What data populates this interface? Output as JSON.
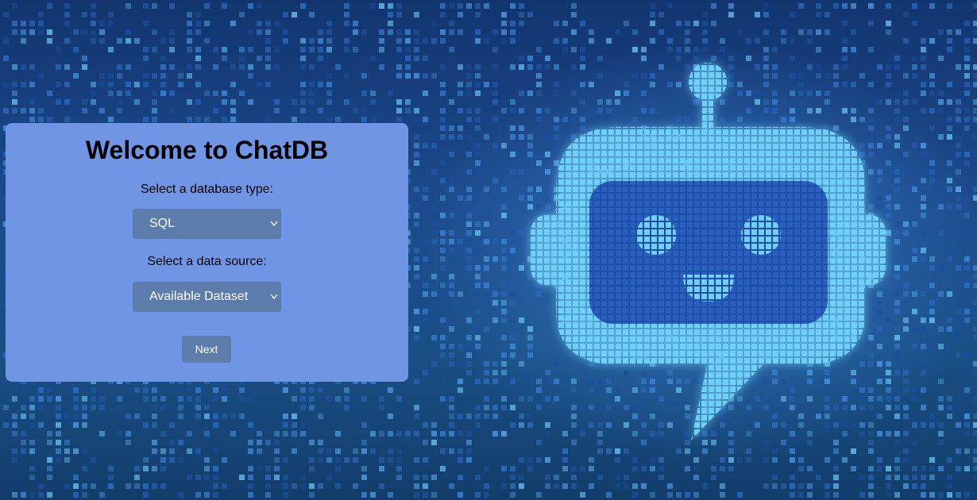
{
  "app": {
    "title": "Welcome to ChatDB"
  },
  "form": {
    "db_type_label": "Select a database type:",
    "db_type_value": "SQL",
    "data_source_label": "Select a data source:",
    "data_source_value": "Available Dataset",
    "next_label": "Next"
  },
  "colors": {
    "card_bg": "#7095e4",
    "control_bg": "#5c7cab",
    "background": "#12356f",
    "robot_glow": "#5fc3f2"
  },
  "icons": {
    "select_arrow": "chevron-down-icon",
    "illustration": "robot-chat-icon"
  }
}
